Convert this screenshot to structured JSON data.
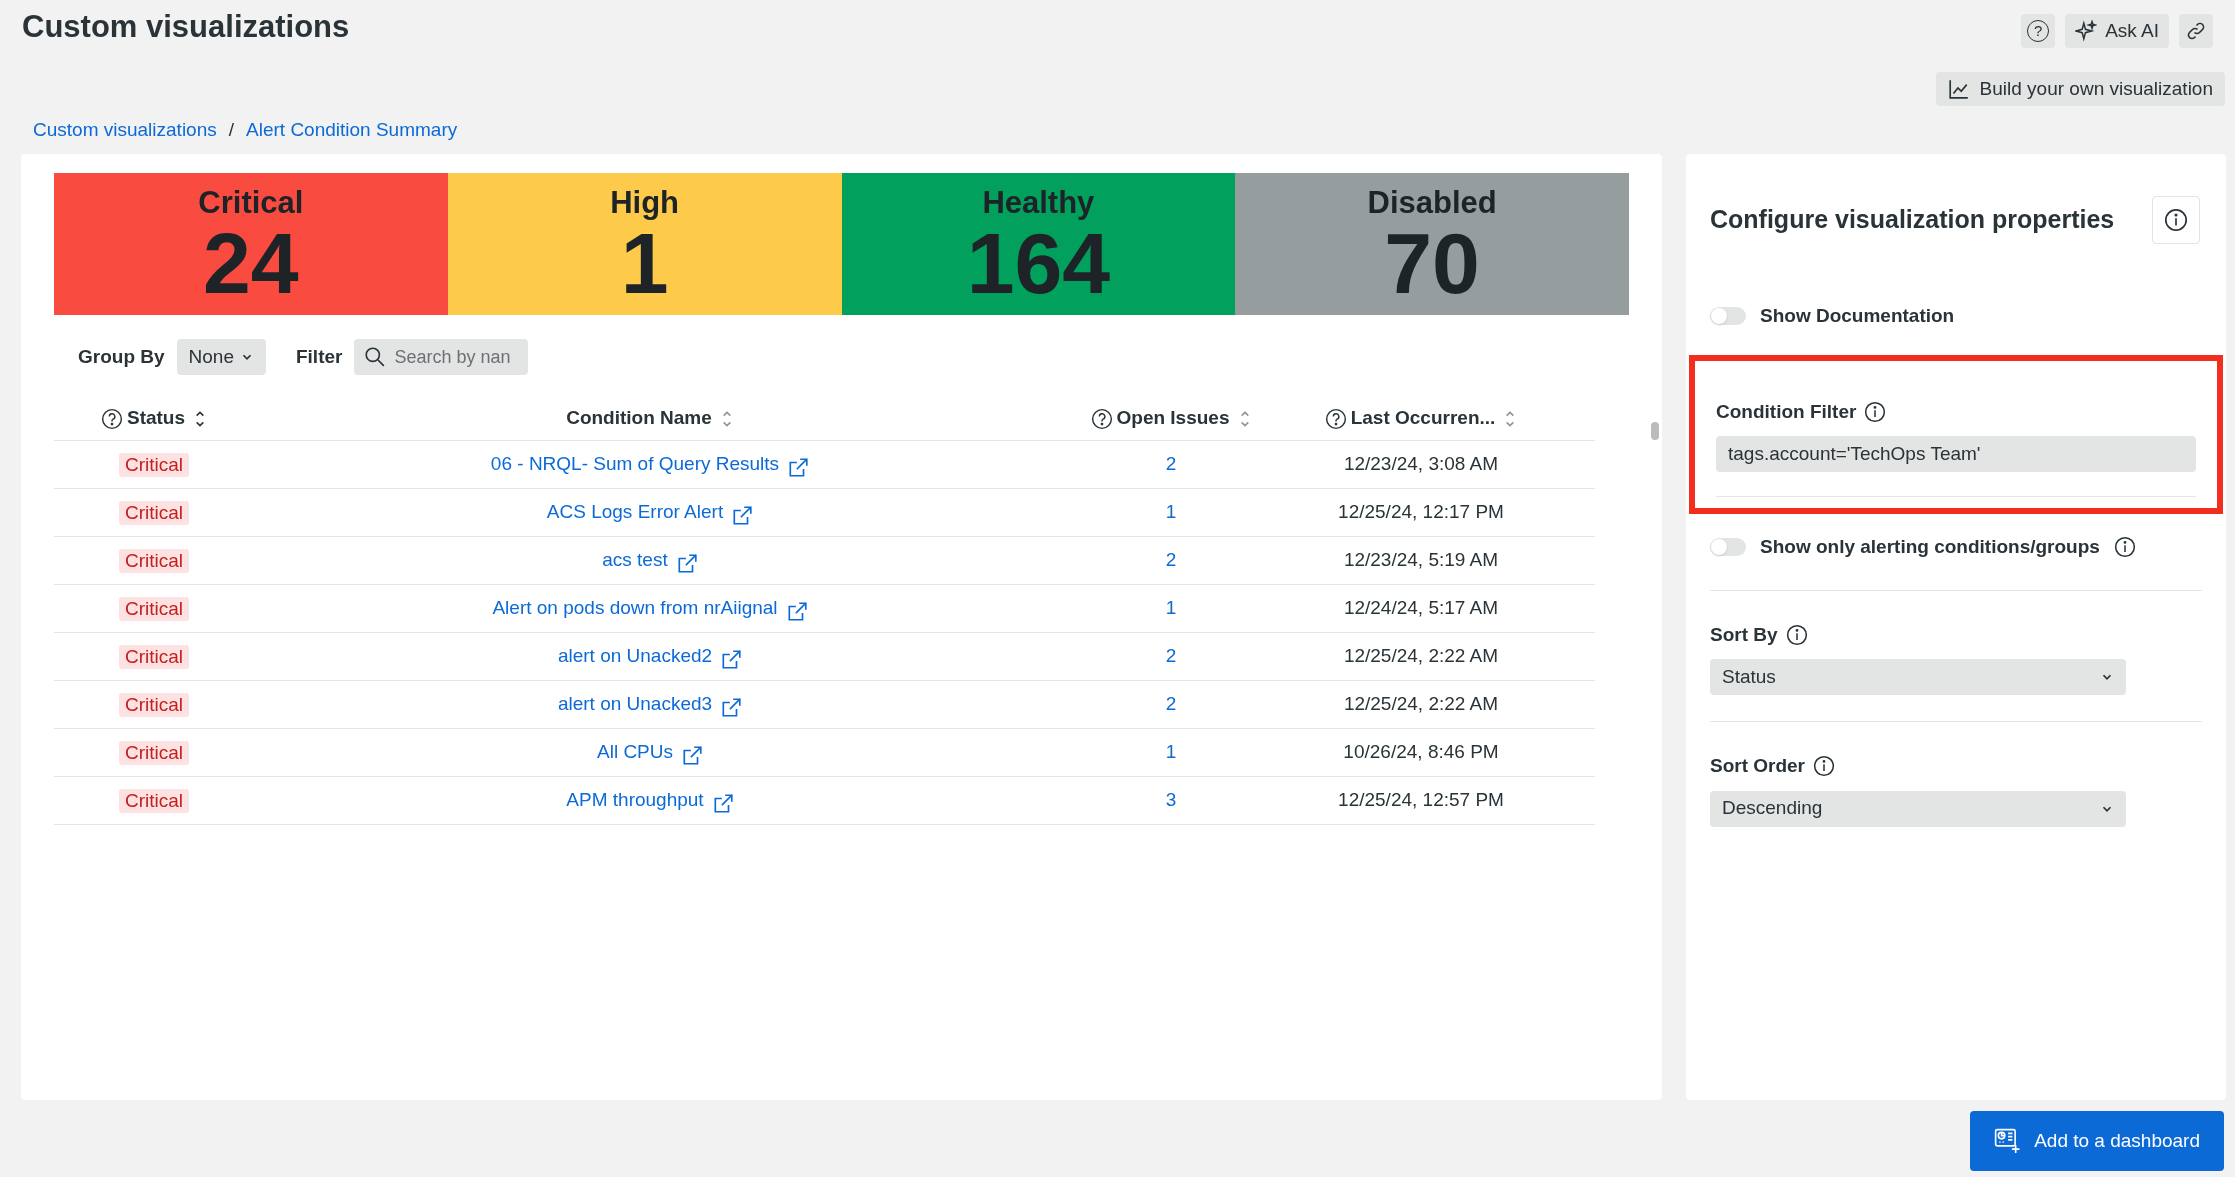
{
  "page": {
    "title": "Custom visualizations",
    "help_button": "?",
    "ask_ai": "Ask AI",
    "build_button": "Build your own visualization"
  },
  "breadcrumb": [
    {
      "label": "Custom visualizations"
    },
    {
      "label": "Alert Condition Summary"
    }
  ],
  "breadcrumb_separator": "/",
  "summary": [
    {
      "label": "Critical",
      "value": "24",
      "color": "#f94b40"
    },
    {
      "label": "High",
      "value": "1",
      "color": "#fdca49"
    },
    {
      "label": "Healthy",
      "value": "164",
      "color": "#01a15d"
    },
    {
      "label": "Disabled",
      "value": "70",
      "color": "#969d9f"
    }
  ],
  "toolbar": {
    "group_by_label": "Group By",
    "group_by_value": "None",
    "filter_label": "Filter",
    "search_placeholder": "Search by nan"
  },
  "table": {
    "columns": [
      {
        "label": "Status",
        "help": true,
        "sorted": true
      },
      {
        "label": "Condition Name",
        "help": false,
        "sorted": false
      },
      {
        "label": "Open Issues",
        "help": true,
        "sorted": false
      },
      {
        "label": "Last Occurren...",
        "help": true,
        "sorted": false
      }
    ],
    "rows": [
      {
        "status": "Critical",
        "name": "06 - NRQL- Sum of Query Results",
        "issues": "2",
        "last": "12/23/24, 3:08 AM"
      },
      {
        "status": "Critical",
        "name": "ACS Logs Error Alert",
        "issues": "1",
        "last": "12/25/24, 12:17 PM"
      },
      {
        "status": "Critical",
        "name": "acs test",
        "issues": "2",
        "last": "12/23/24, 5:19 AM"
      },
      {
        "status": "Critical",
        "name": "Alert on pods down from nrAiignal",
        "issues": "1",
        "last": "12/24/24, 5:17 AM"
      },
      {
        "status": "Critical",
        "name": "alert on Unacked2",
        "issues": "2",
        "last": "12/25/24, 2:22 AM"
      },
      {
        "status": "Critical",
        "name": "alert on Unacked3",
        "issues": "2",
        "last": "12/25/24, 2:22 AM"
      },
      {
        "status": "Critical",
        "name": "All CPUs",
        "issues": "1",
        "last": "10/26/24, 8:46 PM"
      },
      {
        "status": "Critical",
        "name": "APM throughput",
        "issues": "3",
        "last": "12/25/24, 12:57 PM"
      }
    ]
  },
  "panel": {
    "title": "Configure visualization properties",
    "show_documentation": {
      "label": "Show Documentation",
      "on": false
    },
    "condition_filter": {
      "label": "Condition Filter",
      "value": "tags.account='TechOps Team'",
      "highlighted": true
    },
    "show_alerting": {
      "label": "Show only alerting conditions/groups",
      "on": false
    },
    "sort_by": {
      "label": "Sort By",
      "value": "Status"
    },
    "sort_order": {
      "label": "Sort Order",
      "value": "Descending"
    }
  },
  "add_button": "Add to a dashboard"
}
